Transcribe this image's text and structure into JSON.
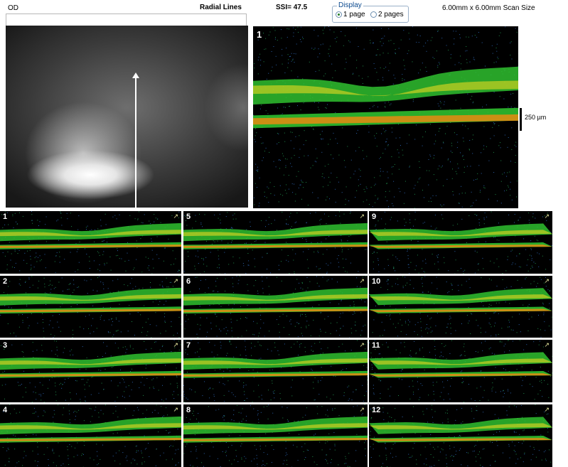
{
  "header": {
    "eye": "OD",
    "title": "Radial Lines",
    "ssi": "SSI= 47.5",
    "scan_size": "6.00mm x 6.00mm Scan Size"
  },
  "display": {
    "legend": "Display",
    "options": [
      {
        "label": "1 page",
        "selected": true
      },
      {
        "label": "2 pages",
        "selected": false
      }
    ]
  },
  "large_scan": {
    "number": "1"
  },
  "scale": {
    "label": "250 µm"
  },
  "thumbnails": [
    {
      "number": "1"
    },
    {
      "number": "5"
    },
    {
      "number": "9"
    },
    {
      "number": "2"
    },
    {
      "number": "6"
    },
    {
      "number": "10"
    },
    {
      "number": "3"
    },
    {
      "number": "7"
    },
    {
      "number": "11"
    },
    {
      "number": "4"
    },
    {
      "number": "8"
    },
    {
      "number": "12"
    }
  ],
  "colors": {
    "retina_green": "#2fbf2f",
    "retina_yellow": "#e8d820",
    "retina_orange": "#e88a10",
    "background": "#000000"
  }
}
